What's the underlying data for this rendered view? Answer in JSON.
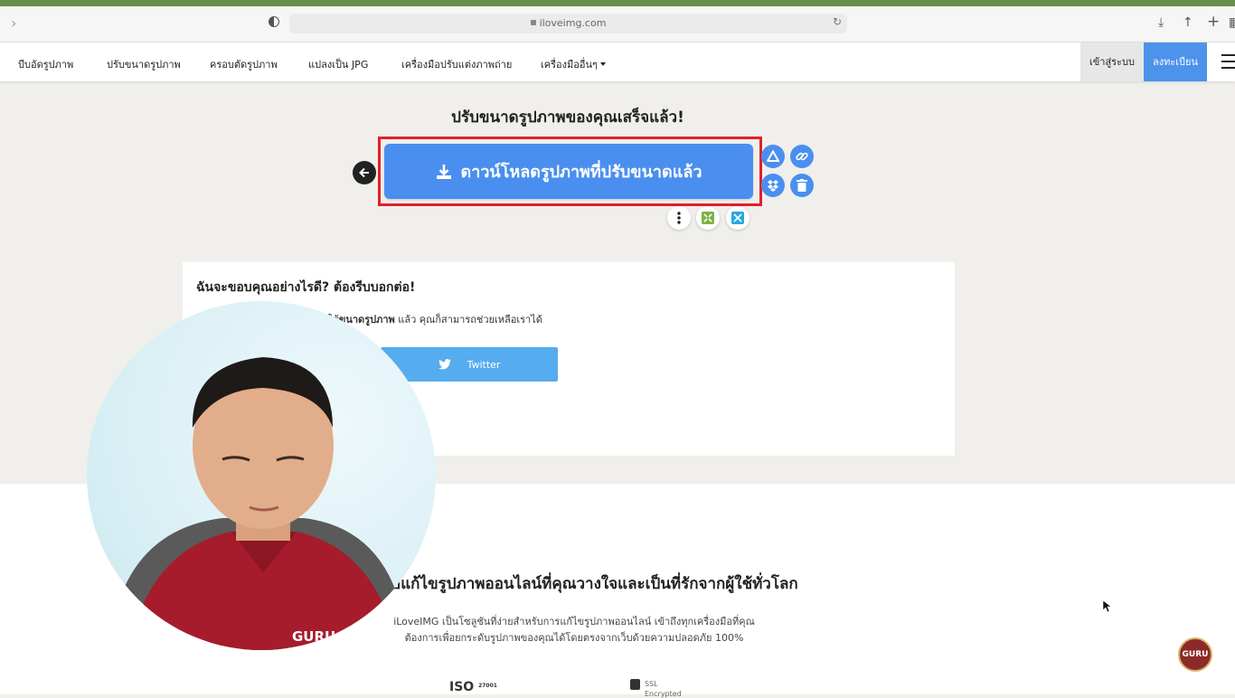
{
  "browser": {
    "url": "iloveimg.com"
  },
  "nav": {
    "items": [
      {
        "label": "บีบอัดรูปภาพ"
      },
      {
        "label": "ปรับขนาดรูปภาพ"
      },
      {
        "label": "ครอบตัดรูปภาพ"
      },
      {
        "label": "แปลงเป็น JPG"
      },
      {
        "label": "เครื่องมือปรับแต่งภาพถ่าย"
      },
      {
        "label": "เครื่องมืออื่นๆ"
      }
    ],
    "login": "เข้าสู่ระบบ",
    "signup": "ลงทะเบียน"
  },
  "main": {
    "title": "ปรับขนาดรูปภาพของคุณเสร็จแล้ว!",
    "download_label": "ดาวน์โหลดรูปภาพที่ปรับขนาดแล้ว"
  },
  "share_card": {
    "heading": "ฉันจะขอบคุณอย่างไรดี? ต้องรีบบอกต่อ!",
    "text_prefix": "ใช้",
    "text_bold": "ขนาดรูปภาพ",
    "text_suffix": " แล้ว คุณก็สามารถช่วยเหลือเราได้",
    "twitter_label": "Twitter"
  },
  "lower": {
    "heading": "อแก้ไขรูปภาพออนไลน์ที่คุณวางใจและเป็นที่รักจากผู้ใช้ทั่วโลก",
    "desc_line1": "iLoveIMG เป็นโซลูชันที่ง่ายสำหรับการแก้ไขรูปภาพออนไลน์ เข้าถึงทุกเครื่องมือที่คุณ",
    "desc_line2": "ต้องการเพื่อยกระดับรูปภาพของคุณได้โดยตรงจากเว็บด้วยความปลอดภัย 100%",
    "iso_label": "ISO",
    "iso_number": "27001",
    "ssl_label": "SSL",
    "ssl_sub": "Encrypted"
  },
  "overlay": {
    "shirt_text": "GURU",
    "badge_text": "GURU"
  },
  "colors": {
    "primary": "#4a8ff0",
    "highlight": "#e41f26",
    "twitter": "#55acee"
  }
}
